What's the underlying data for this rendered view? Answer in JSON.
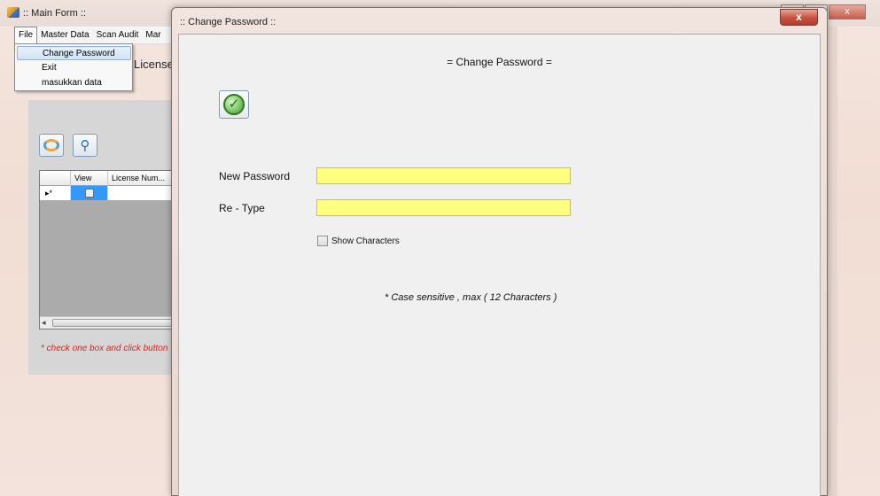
{
  "main_form": {
    "title": ":: Main Form ::",
    "menu": [
      "File",
      "Master Data",
      "Scan Audit",
      "Mar"
    ],
    "file_menu_items": [
      "Change Password",
      "Exit",
      "masukkan data"
    ],
    "license_label": "License",
    "grid": {
      "row_indicator": "▸*",
      "columns": [
        "View",
        "License Num..."
      ]
    },
    "hint": "* check one box and click button",
    "controls": {
      "minimize": "▭",
      "maximize": "▣",
      "close": "x"
    }
  },
  "dialog": {
    "title": ":: Change Password ::",
    "close": "x",
    "heading": "= Change Password =",
    "new_password_label": "New Password",
    "new_password_value": "",
    "retype_label": "Re - Type",
    "retype_value": "",
    "show_characters_label": "Show Characters",
    "show_characters_checked": false,
    "case_note": "* Case sensitive , max ( 12 Characters )",
    "ok_icon": "✓"
  },
  "colors": {
    "field_background": "#ffff80",
    "hint_text": "#e02020",
    "selection": "#3399ff"
  },
  "icons": {
    "ok_button": "check-icon",
    "refresh_button": "refresh-icon",
    "search_button": "search-icon"
  }
}
